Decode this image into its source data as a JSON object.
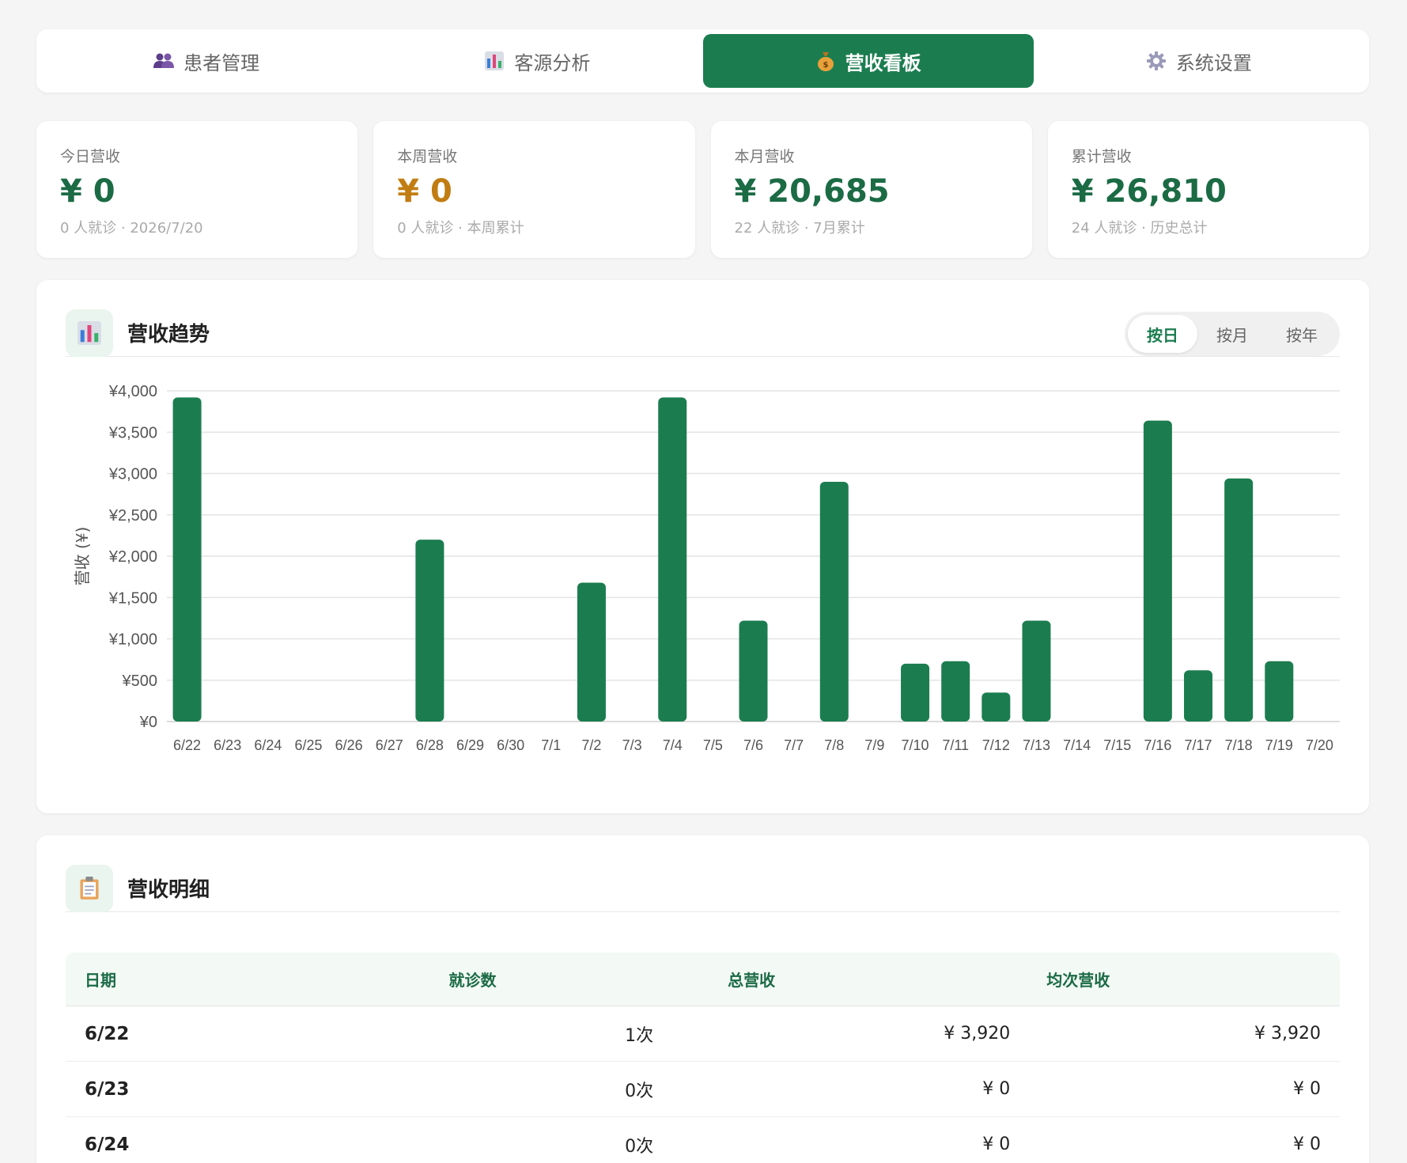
{
  "nav": {
    "tabs": [
      {
        "label": "患者管理",
        "icon": "users-icon",
        "active": false
      },
      {
        "label": "客源分析",
        "icon": "bar-chart-icon",
        "active": false
      },
      {
        "label": "营收看板",
        "icon": "money-bag-icon",
        "active": true
      },
      {
        "label": "系统设置",
        "icon": "gear-icon",
        "active": false
      }
    ]
  },
  "stats": [
    {
      "label": "今日营收",
      "value": "¥ 0",
      "sub": "0 人就诊 · 2026/7/20",
      "color": "#1b6b45"
    },
    {
      "label": "本周营收",
      "value": "¥ 0",
      "sub": "0 人就诊 · 本周累计",
      "color": "#c17d12"
    },
    {
      "label": "本月营收",
      "value": "¥ 20,685",
      "sub": "22 人就诊 · 7月累计",
      "color": "#1b6b45"
    },
    {
      "label": "累计营收",
      "value": "¥ 26,810",
      "sub": "24 人就诊 · 历史总计",
      "color": "#1b6b45"
    }
  ],
  "trend": {
    "title": "营收趋势",
    "segments": [
      {
        "label": "按日",
        "active": true
      },
      {
        "label": "按月",
        "active": false
      },
      {
        "label": "按年",
        "active": false
      }
    ]
  },
  "chart_data": {
    "type": "bar",
    "categories": [
      "6/22",
      "6/23",
      "6/24",
      "6/25",
      "6/26",
      "6/27",
      "6/28",
      "6/29",
      "6/30",
      "7/1",
      "7/2",
      "7/3",
      "7/4",
      "7/5",
      "7/6",
      "7/7",
      "7/8",
      "7/9",
      "7/10",
      "7/11",
      "7/12",
      "7/13",
      "7/14",
      "7/15",
      "7/16",
      "7/17",
      "7/18",
      "7/19",
      "7/20"
    ],
    "values": [
      3920,
      0,
      0,
      0,
      0,
      0,
      2200,
      0,
      0,
      0,
      1680,
      0,
      3920,
      0,
      1220,
      0,
      2900,
      0,
      700,
      730,
      350,
      1220,
      0,
      0,
      3640,
      620,
      2940,
      730,
      0
    ],
    "ylabel": "营收 (¥)",
    "ylim": [
      0,
      4000
    ],
    "yticks": [
      0,
      500,
      1000,
      1500,
      2000,
      2500,
      3000,
      3500,
      4000
    ],
    "ytick_labels": [
      "¥0",
      "¥500",
      "¥1,000",
      "¥1,500",
      "¥2,000",
      "¥2,500",
      "¥3,000",
      "¥3,500",
      "¥4,000"
    ],
    "bar_color": "#1b7d4f",
    "grid": true
  },
  "detail": {
    "title": "营收明细",
    "columns": [
      "日期",
      "就诊数",
      "总营收",
      "均次营收"
    ],
    "rows": [
      {
        "date": "6/22",
        "visits": "1次",
        "total": "¥ 3,920",
        "avg": "¥ 3,920"
      },
      {
        "date": "6/23",
        "visits": "0次",
        "total": "¥ 0",
        "avg": "¥ 0"
      },
      {
        "date": "6/24",
        "visits": "0次",
        "total": "¥ 0",
        "avg": "¥ 0"
      }
    ]
  }
}
